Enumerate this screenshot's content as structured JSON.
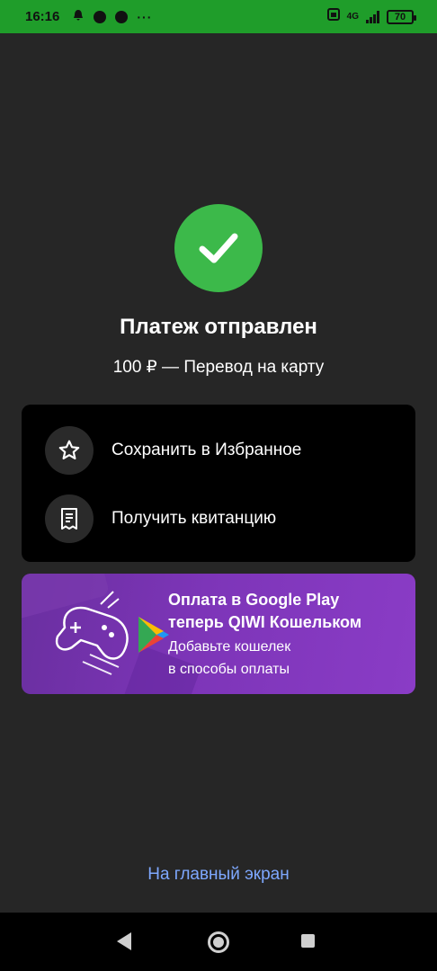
{
  "status_bar": {
    "time": "16:16",
    "battery": "70",
    "network": "4G"
  },
  "result": {
    "title": "Платеж отправлен",
    "subtitle": "100 ₽ — Перевод на карту"
  },
  "actions": [
    {
      "label": "Сохранить в Избранное",
      "icon": "star-icon"
    },
    {
      "label": "Получить квитанцию",
      "icon": "receipt-icon"
    }
  ],
  "banner": {
    "headline_line1": "Оплата в Google Play",
    "headline_line2": "теперь QIWI Кошельком",
    "body_line1": "Добавьте кошелек",
    "body_line2": "в способы оплаты"
  },
  "home_link": "На главный экран",
  "colors": {
    "status_bar": "#1f9d2a",
    "success": "#3cb94a",
    "background": "#262626",
    "link": "#7ea8ff",
    "banner": "#7d35b8"
  }
}
